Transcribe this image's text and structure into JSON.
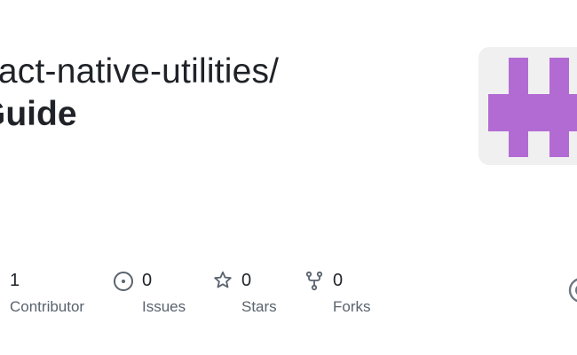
{
  "repo": {
    "path": "eact-native-utilities/",
    "name": "Guide"
  },
  "stats": [
    {
      "count": "1",
      "label": "Contributor",
      "icon": "people-icon"
    },
    {
      "count": "0",
      "label": "Issues",
      "icon": "issue-opened-icon"
    },
    {
      "count": "0",
      "label": "Stars",
      "icon": "star-icon"
    },
    {
      "count": "0",
      "label": "Forks",
      "icon": "repo-forked-icon"
    }
  ],
  "colors": {
    "avatar_bg": "#f0f0f0",
    "avatar_fg": "#b36bd4",
    "muted_text": "#59636e",
    "icon": "#59636e",
    "corner_icon": "#6e7781"
  },
  "avatar_icon": "org-logo-icon",
  "corner_icon": "github-mark-icon"
}
